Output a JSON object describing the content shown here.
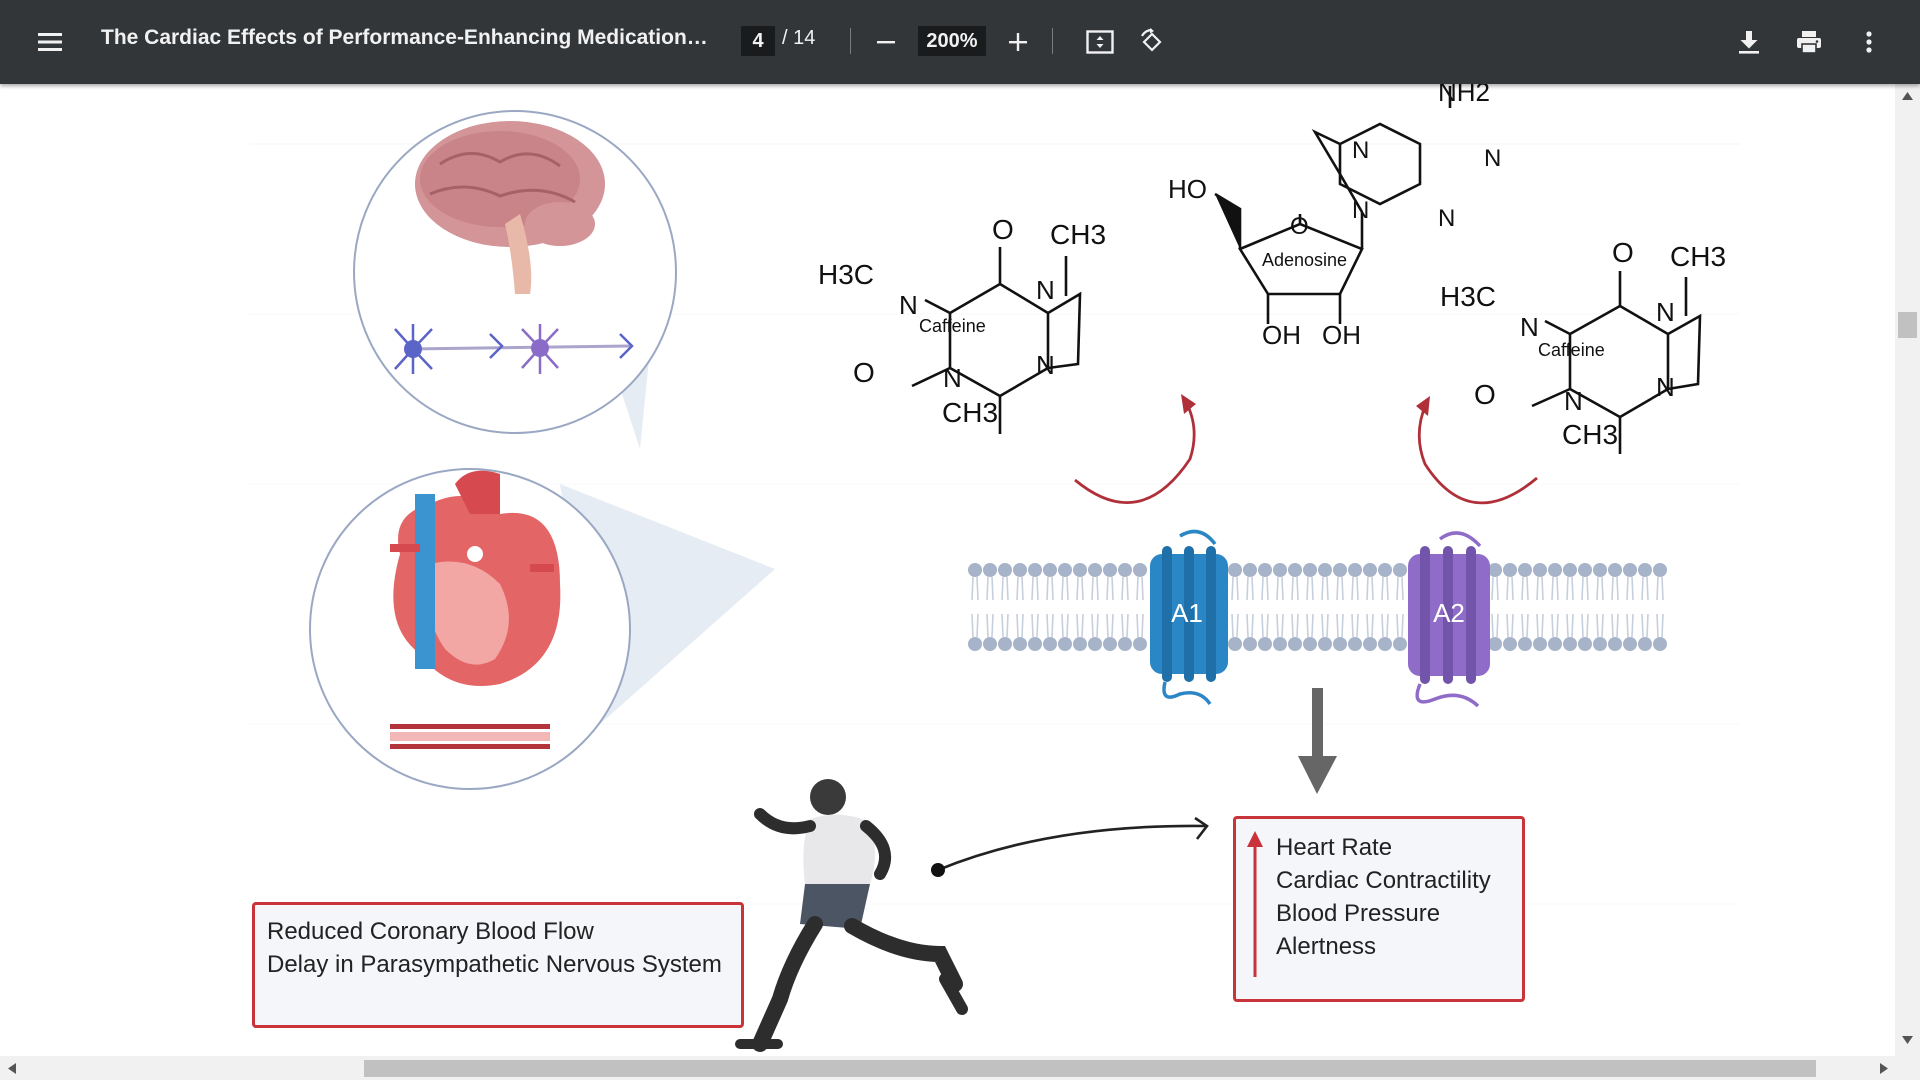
{
  "toolbar": {
    "menu_icon": "hamburger-menu-icon",
    "title": "The Cardiac Effects of Performance-Enhancing Medications: C...",
    "page_current": "4",
    "page_total": "/ 14",
    "zoom": "200%",
    "icons": {
      "zoom_out": "minus-icon",
      "zoom_in": "plus-icon",
      "fit": "fit-page-icon",
      "rotate": "rotate-icon",
      "download": "download-icon",
      "print": "print-icon",
      "more": "more-vert-icon"
    }
  },
  "figure": {
    "molecules": {
      "caffeine_left": {
        "name": "Caffeine",
        "ch3_top": "CH3",
        "h3c": "H3C",
        "ch3_bottom": "CH3",
        "o": "O",
        "n": "N"
      },
      "adenosine": {
        "name": "Adenosine",
        "nh2": "NH2",
        "ho": "HO",
        "oh1": "OH",
        "oh2": "OH",
        "o": "O",
        "n": "N"
      },
      "caffeine_right": {
        "name": "Caffeine",
        "ch3_top": "CH3",
        "h3c": "H3C",
        "ch3_bottom": "CH3",
        "o": "O",
        "n": "N"
      }
    },
    "receptors": {
      "a1": "A1",
      "a2": "A2"
    },
    "effects_box": {
      "arrow": "up-arrow-icon",
      "items": [
        "Heart Rate",
        "Cardiac Contractility",
        "Blood Pressure",
        "Alertness"
      ]
    },
    "reduced_box": {
      "line1": "Reduced Coronary Blood Flow",
      "line2": "Delay in Parasympathetic Nervous System"
    },
    "colors": {
      "receptor_a1": "#2b86c5",
      "receptor_a2": "#8f6cc8",
      "box_border": "#c9343a",
      "arc_arrow": "#b0303a",
      "toolbar": "#323639"
    }
  }
}
